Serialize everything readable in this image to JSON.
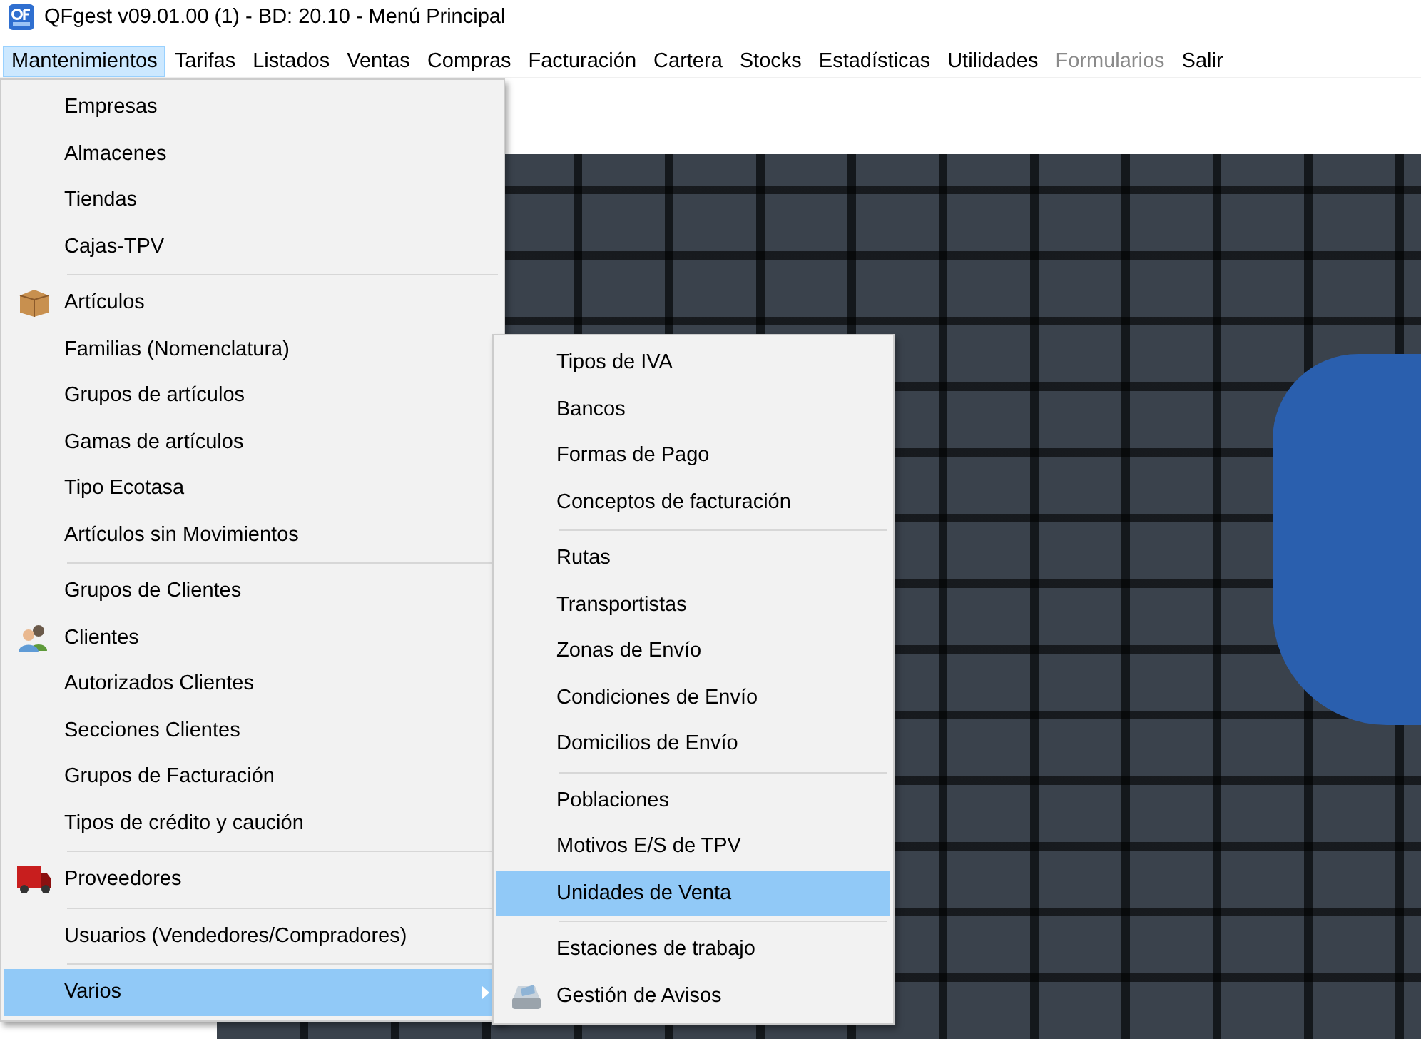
{
  "window": {
    "title": "QFgest v09.01.00 (1) - BD: 20.10 -  Menú Principal"
  },
  "menubar": [
    {
      "label": "Mantenimientos",
      "selected": true,
      "disabled": false
    },
    {
      "label": "Tarifas",
      "selected": false,
      "disabled": false
    },
    {
      "label": "Listados",
      "selected": false,
      "disabled": false
    },
    {
      "label": "Ventas",
      "selected": false,
      "disabled": false
    },
    {
      "label": "Compras",
      "selected": false,
      "disabled": false
    },
    {
      "label": "Facturación",
      "selected": false,
      "disabled": false
    },
    {
      "label": "Cartera",
      "selected": false,
      "disabled": false
    },
    {
      "label": "Stocks",
      "selected": false,
      "disabled": false
    },
    {
      "label": "Estadísticas",
      "selected": false,
      "disabled": false
    },
    {
      "label": "Utilidades",
      "selected": false,
      "disabled": false
    },
    {
      "label": "Formularios",
      "selected": false,
      "disabled": true
    },
    {
      "label": "Salir",
      "selected": false,
      "disabled": false
    }
  ],
  "main_menu": {
    "groups": [
      [
        {
          "label": "Empresas",
          "kind": "plain",
          "selected": false,
          "has_submenu": false
        },
        {
          "label": "Almacenes",
          "kind": "plain",
          "selected": false,
          "has_submenu": false
        },
        {
          "label": "Tiendas",
          "kind": "plain",
          "selected": false,
          "has_submenu": false
        },
        {
          "label": "Cajas-TPV",
          "kind": "plain",
          "selected": false,
          "has_submenu": false
        }
      ],
      [
        {
          "label": "Artículos",
          "kind": "product",
          "selected": false,
          "has_submenu": false
        },
        {
          "label": "Familias (Nomenclatura)",
          "kind": "plain",
          "selected": false,
          "has_submenu": false
        },
        {
          "label": "Grupos de artículos",
          "kind": "plain",
          "selected": false,
          "has_submenu": false
        },
        {
          "label": "Gamas de artículos",
          "kind": "plain",
          "selected": false,
          "has_submenu": false
        },
        {
          "label": "Tipo Ecotasa",
          "kind": "plain",
          "selected": false,
          "has_submenu": false
        },
        {
          "label": "Artículos sin Movimientos",
          "kind": "plain",
          "selected": false,
          "has_submenu": false
        }
      ],
      [
        {
          "label": "Grupos de Clientes",
          "kind": "plain",
          "selected": false,
          "has_submenu": false
        },
        {
          "label": "Clientes",
          "kind": "customer",
          "selected": false,
          "has_submenu": false
        },
        {
          "label": "Autorizados Clientes",
          "kind": "plain",
          "selected": false,
          "has_submenu": false
        },
        {
          "label": "Secciones Clientes",
          "kind": "plain",
          "selected": false,
          "has_submenu": false
        },
        {
          "label": "Grupos de Facturación",
          "kind": "plain",
          "selected": false,
          "has_submenu": false
        },
        {
          "label": "Tipos de crédito y caución",
          "kind": "plain",
          "selected": false,
          "has_submenu": false
        }
      ],
      [
        {
          "label": "Proveedores",
          "kind": "supplier",
          "selected": false,
          "has_submenu": false
        }
      ],
      [
        {
          "label": "Usuarios (Vendedores/Compradores)",
          "kind": "plain",
          "selected": false,
          "has_submenu": false
        }
      ],
      [
        {
          "label": "Varios",
          "kind": "plain",
          "selected": true,
          "has_submenu": true
        }
      ]
    ]
  },
  "submenu": {
    "groups": [
      [
        {
          "label": "Tipos de IVA",
          "kind": "plain",
          "selected": false
        },
        {
          "label": "Bancos",
          "kind": "plain",
          "selected": false
        },
        {
          "label": "Formas de Pago",
          "kind": "plain",
          "selected": false
        },
        {
          "label": "Conceptos de facturación",
          "kind": "plain",
          "selected": false
        }
      ],
      [
        {
          "label": "Rutas",
          "kind": "plain",
          "selected": false
        },
        {
          "label": "Transportistas",
          "kind": "plain",
          "selected": false
        },
        {
          "label": "Zonas de Envío",
          "kind": "plain",
          "selected": false
        },
        {
          "label": "Condiciones de Envío",
          "kind": "plain",
          "selected": false
        },
        {
          "label": "Domicilios de Envío",
          "kind": "plain",
          "selected": false
        }
      ],
      [
        {
          "label": "Poblaciones",
          "kind": "plain",
          "selected": false
        },
        {
          "label": "Motivos E/S de TPV",
          "kind": "plain",
          "selected": false
        },
        {
          "label": "Unidades de Venta",
          "kind": "plain",
          "selected": true
        }
      ],
      [
        {
          "label": "Estaciones de trabajo",
          "kind": "plain",
          "selected": false
        },
        {
          "label": "Gestión de Avisos",
          "kind": "notice",
          "selected": false
        }
      ]
    ]
  }
}
